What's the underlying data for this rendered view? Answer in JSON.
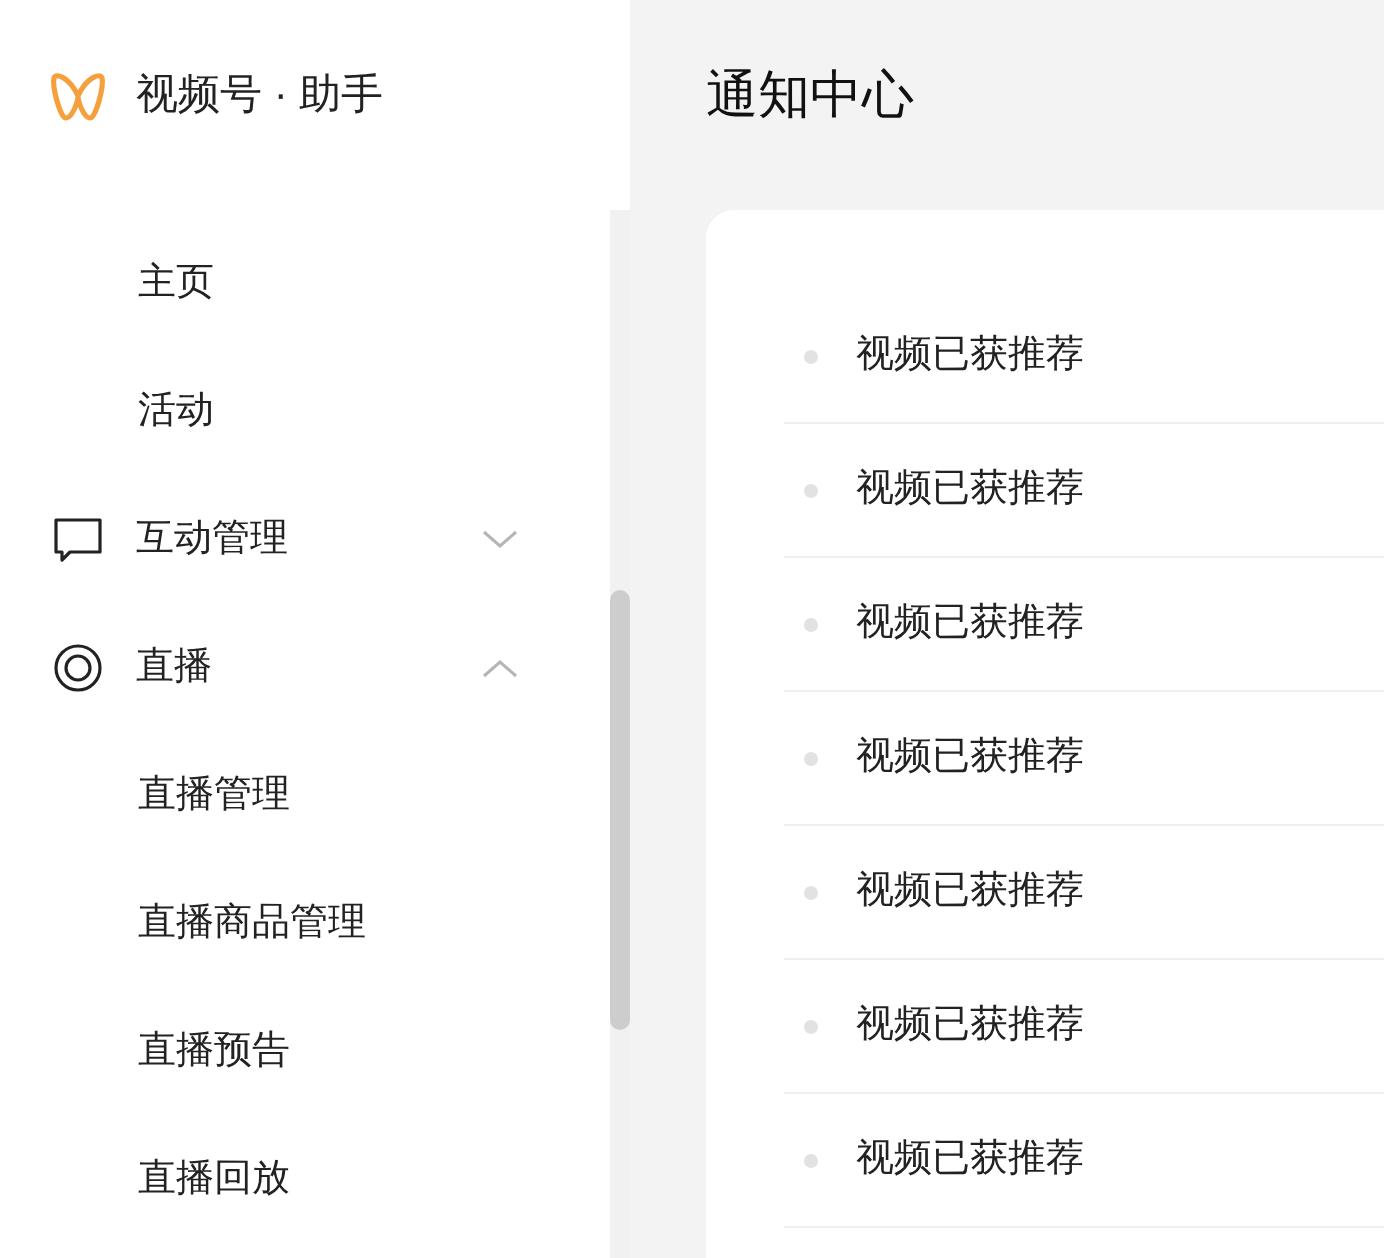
{
  "brand": {
    "name": "视频号 · 助手"
  },
  "sidebar": {
    "items": [
      {
        "kind": "link",
        "label": "主页"
      },
      {
        "kind": "link",
        "label": "活动"
      },
      {
        "kind": "group",
        "label": "互动管理",
        "expanded": false
      },
      {
        "kind": "group",
        "label": "直播",
        "expanded": true,
        "children": [
          {
            "label": "直播管理"
          },
          {
            "label": "直播商品管理"
          },
          {
            "label": "直播预告"
          },
          {
            "label": "直播回放"
          }
        ]
      }
    ]
  },
  "page": {
    "title": "通知中心"
  },
  "notifications": [
    {
      "text": "视频已获推荐"
    },
    {
      "text": "视频已获推荐"
    },
    {
      "text": "视频已获推荐"
    },
    {
      "text": "视频已获推荐"
    },
    {
      "text": "视频已获推荐"
    },
    {
      "text": "视频已获推荐"
    },
    {
      "text": "视频已获推荐"
    }
  ]
}
